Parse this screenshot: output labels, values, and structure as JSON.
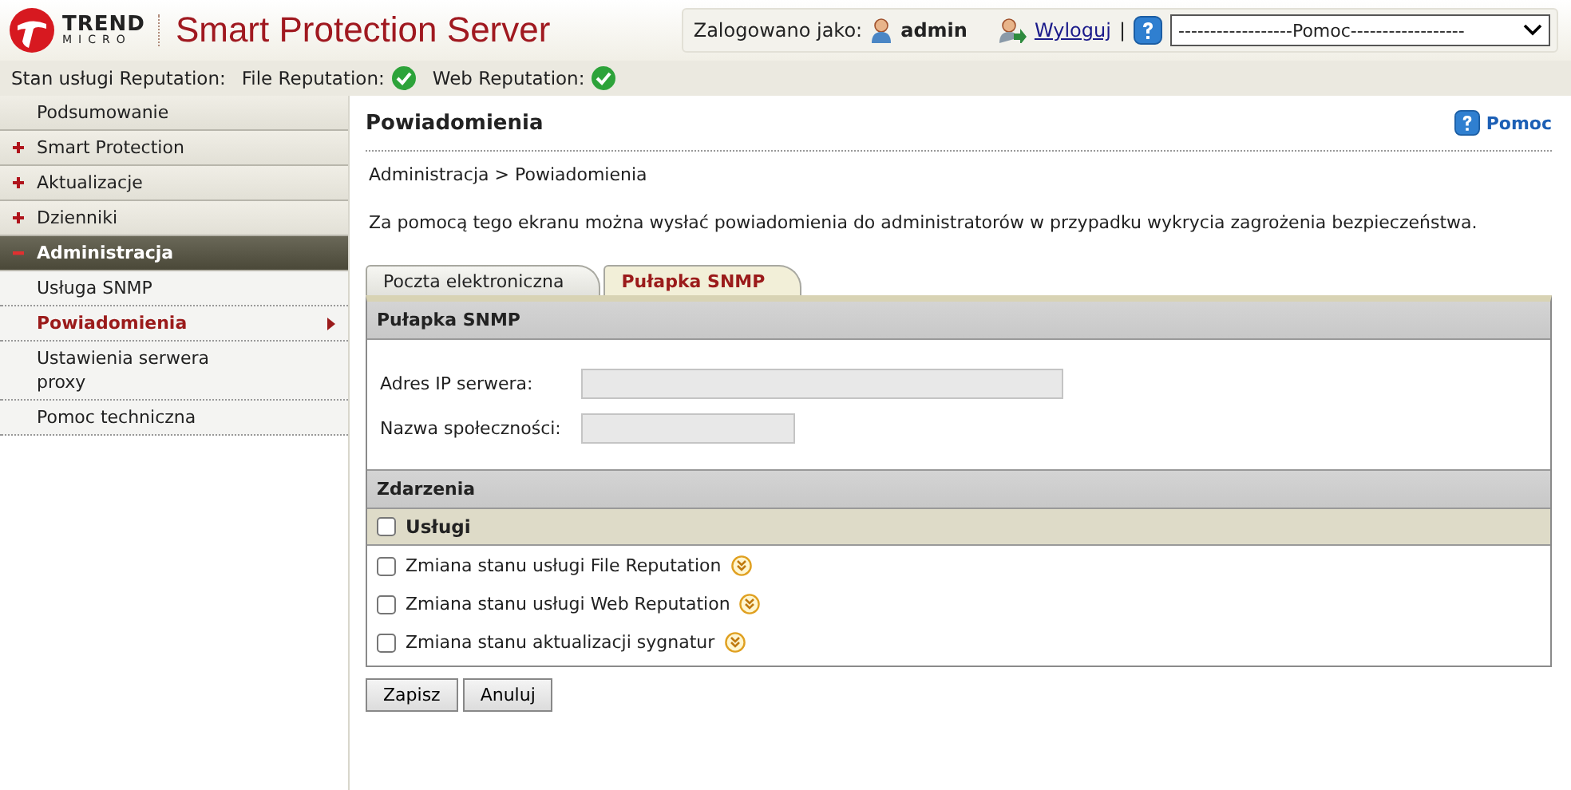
{
  "header": {
    "brand_top": "TREND",
    "brand_bottom": "MICRO",
    "title": "Smart Protection Server",
    "logged_in_label": "Zalogowano jako:",
    "user": "admin",
    "logout": "Wyloguj",
    "separator": "|",
    "help_select": "------------------Pomoc------------------"
  },
  "status": {
    "label": "Stan usługi Reputation:",
    "services": [
      {
        "name": "File Reputation:",
        "ok": true
      },
      {
        "name": "Web Reputation:",
        "ok": true
      }
    ]
  },
  "sidebar": {
    "items": [
      {
        "label": "Podsumowanie",
        "kind": "link"
      },
      {
        "label": "Smart Protection",
        "kind": "group",
        "expanded": false
      },
      {
        "label": "Aktualizacje",
        "kind": "group",
        "expanded": false
      },
      {
        "label": "Dzienniki",
        "kind": "group",
        "expanded": false
      },
      {
        "label": "Administracja",
        "kind": "group",
        "expanded": true,
        "children": [
          {
            "label": "Usługa SNMP",
            "selected": false
          },
          {
            "label": "Powiadomienia",
            "selected": true
          },
          {
            "label": "Ustawienia serwera proxy",
            "selected": false
          },
          {
            "label": "Pomoc techniczna",
            "selected": false
          }
        ]
      }
    ]
  },
  "page": {
    "title": "Powiadomienia",
    "help_link": "Pomoc",
    "breadcrumb": "Administracja > Powiadomienia",
    "description": "Za pomocą tego ekranu można wysłać powiadomienia do administratorów w przypadku wykrycia zagrożenia bezpieczeństwa.",
    "tabs": [
      {
        "label": "Poczta elektroniczna",
        "selected": false
      },
      {
        "label": "Pułapka SNMP",
        "selected": true
      }
    ],
    "section_title": "Pułapka SNMP",
    "fields": [
      {
        "label": "Adres IP serwera:"
      },
      {
        "label": "Nazwa społeczności:"
      }
    ],
    "events_title": "Zdarzenia",
    "events_group": {
      "label": "Usługi",
      "checked": false
    },
    "events": [
      {
        "label": "Zmiana stanu usługi File Reputation",
        "checked": false
      },
      {
        "label": "Zmiana stanu usługi Web Reputation",
        "checked": false
      },
      {
        "label": "Zmiana stanu aktualizacji sygnatur",
        "checked": false
      }
    ],
    "buttons": [
      "Zapisz",
      "Anuluj"
    ]
  }
}
